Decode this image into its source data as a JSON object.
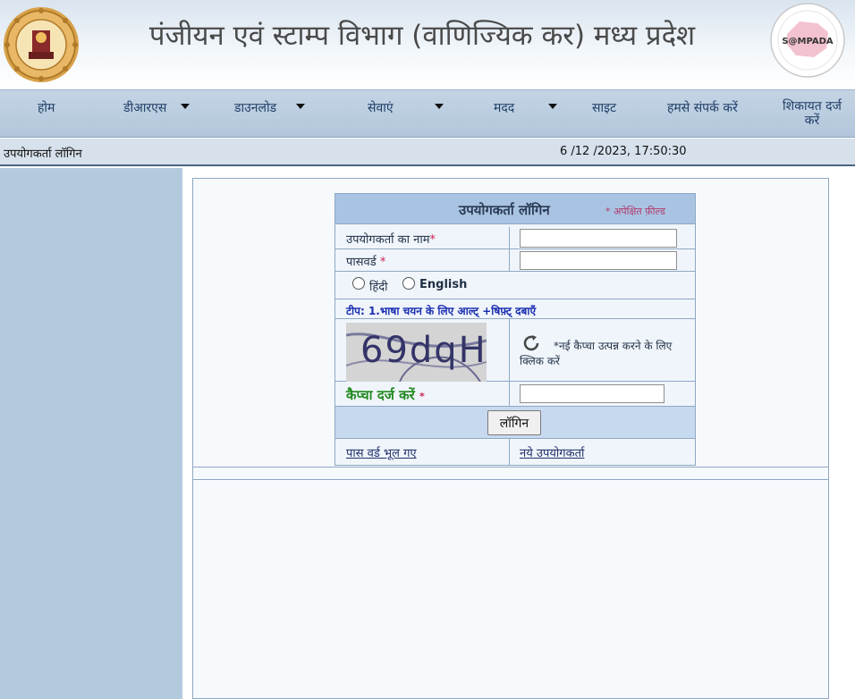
{
  "header": {
    "title": "पंजीयन एवं स्टाम्प विभाग (वाणिज्यिक कर) मध्य प्रदेश",
    "emblem_icon": "mp-state-emblem-icon",
    "logo_text": "S@MPADA"
  },
  "nav": {
    "items": [
      {
        "label": "होम",
        "dropdown": false
      },
      {
        "label": "डीआरएस",
        "dropdown": true
      },
      {
        "label": "डाउनलोड",
        "dropdown": true
      },
      {
        "label": "सेवाएं",
        "dropdown": true
      },
      {
        "label": "मदद",
        "dropdown": true
      },
      {
        "label": "साइट",
        "dropdown": false
      },
      {
        "label": "हमसे संपर्क करें",
        "dropdown": false
      }
    ],
    "complaint_line1": "शिकायत दर्ज",
    "complaint_line2": "करें"
  },
  "status": {
    "page_label": "उपयोगकर्ता लॉगिन",
    "datetime": "6 /12 /2023, 17:50:30"
  },
  "login": {
    "title": "उपयोगकर्ता लॉगिन",
    "required_note": "* अपेक्षित फ़ील्ड",
    "username_label": "उपयोगकर्ता का नाम",
    "username_value": "",
    "password_label": "पासवर्ड ",
    "password_value": "",
    "required_mark": "*",
    "lang_hindi": "हिंदी",
    "lang_english": "English",
    "tip": "टीप: 1.भाषा चयन के लिए आल्ट् +षिफ़्ट् दबाएँ",
    "captcha_text": "69dqH",
    "refresh_text": "*नई कैप्चा उत्पन्न करने के लिए क्लिक करें",
    "captcha_label": "कैप्चा दर्ज करें ",
    "captcha_value": "",
    "login_button": "लॉगिन",
    "forgot_password": "पास वर्ड भूल गए",
    "new_user": "नये उपयोगकर्ता"
  },
  "colors": {
    "nav_bg": "#b2c6db",
    "sidebar_bg": "#b3cade",
    "login_header_bg": "#a9c3e3",
    "captcha_label": "#208a1e",
    "required": "#cc2255"
  }
}
